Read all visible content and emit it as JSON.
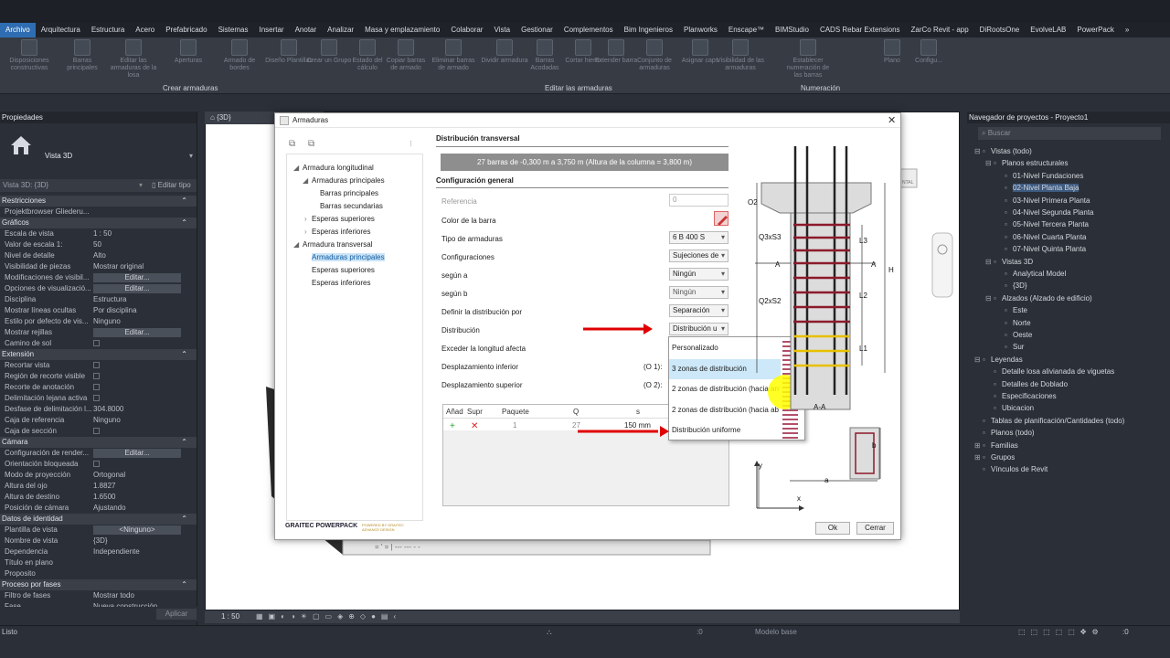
{
  "ribbon": {
    "tabs": [
      "Archivo",
      "Arquitectura",
      "Estructura",
      "Acero",
      "Prefabricado",
      "Sistemas",
      "Insertar",
      "Anotar",
      "Analizar",
      "Masa y emplazamiento",
      "Colaborar",
      "Vista",
      "Gestionar",
      "Complementos",
      "Bim Ingenieros",
      "Planworks",
      "Enscape™",
      "BIMStudio",
      "CADS Rebar Extensions",
      "ZarCo Revit - app",
      "DiRootsOne",
      "EvolveLAB",
      "PowerPack"
    ],
    "buttons": [
      "Disposiciones constructivas",
      "Barras principales",
      "Editar las armaduras de la losa",
      "Aperturas",
      "Armado de bordes",
      "Diseño Plantillas",
      "Crear un Grupo",
      "Estado del cálculo",
      "Copiar barras de armado",
      "Eliminar barras de armado",
      "Dividir armadura",
      "Barras Acodadas",
      "Cortar hierro",
      "Extender barra",
      "Conjunto de armaduras",
      "Asignar caps",
      "Visibilidad de las armaduras",
      "Establecer numeración de las barras",
      "Plano",
      "Configu..."
    ],
    "groups": [
      "Crear armaduras",
      "Editar las armaduras",
      "Numeración"
    ]
  },
  "properties": {
    "title": "Propiedades",
    "type_name": "Vista 3D",
    "selector": "Vista 3D: {3D}",
    "edit_type": "Editar tipo",
    "sections": [
      {
        "name": "Restricciones",
        "toggle": "⌃",
        "rows": [
          [
            "Projektbrowser Gliederu...",
            ""
          ]
        ]
      },
      {
        "name": "Gráficos",
        "toggle": "⌃",
        "rows": [
          [
            "Escala de vista",
            "1 : 50"
          ],
          [
            "Valor de escala    1:",
            "50"
          ],
          [
            "Nivel de detalle",
            "Alto"
          ],
          [
            "Visibilidad de piezas",
            "Mostrar original"
          ],
          [
            "Modificaciones de visibil...",
            "Editar..."
          ],
          [
            "Opciones de visualizació...",
            "Editar..."
          ],
          [
            "Disciplina",
            "Estructura"
          ],
          [
            "Mostrar líneas ocultas",
            "Por disciplina"
          ],
          [
            "Estilo por defecto de vis...",
            "Ninguno"
          ],
          [
            "Mostrar rejillas",
            "Editar..."
          ],
          [
            "Camino de sol",
            "☐"
          ]
        ]
      },
      {
        "name": "Extensión",
        "toggle": "⌃",
        "rows": [
          [
            "Recortar vista",
            "☐"
          ],
          [
            "Región de recorte visible",
            "☐"
          ],
          [
            "Recorte de anotación",
            "☐"
          ],
          [
            "Delimitación lejana activa",
            "☐"
          ],
          [
            "Desfase de delimitación l...",
            "304.8000"
          ],
          [
            "Caja de referencia",
            "Ninguno"
          ],
          [
            "Caja de sección",
            "☐"
          ]
        ]
      },
      {
        "name": "Cámara",
        "toggle": "⌃",
        "rows": [
          [
            "Configuración de render...",
            "Editar..."
          ],
          [
            "Orientación bloqueada",
            "☐"
          ],
          [
            "Modo de proyección",
            "Ortogonal"
          ],
          [
            "Altura del ojo",
            "1.8827"
          ],
          [
            "Altura de destino",
            "1.6500"
          ],
          [
            "Posición de cámara",
            "Ajustando"
          ]
        ]
      },
      {
        "name": "Datos de identidad",
        "toggle": "⌃",
        "rows": [
          [
            "Plantilla de vista",
            "<Ninguno>"
          ],
          [
            "Nombre de vista",
            "{3D}"
          ],
          [
            "Dependencia",
            "Independiente"
          ],
          [
            "Título en plano",
            ""
          ],
          [
            "Proposito",
            ""
          ]
        ]
      },
      {
        "name": "Proceso por fases",
        "toggle": "⌃",
        "rows": [
          [
            "Filtro de fases",
            "Mostrar todo"
          ],
          [
            "Fase",
            "Nueva construcción"
          ]
        ]
      }
    ],
    "apply": "Aplicar"
  },
  "viewport": {
    "tab": "{3D}",
    "scale": "1 : 50"
  },
  "status": {
    "left": "Listo",
    "model": "Modelo base",
    "count1": ":0",
    "count2": ":0"
  },
  "browser": {
    "title": "Navegador de proyectos - Proyecto1",
    "search": "Buscar",
    "items": [
      [
        "Vistas (todo)",
        0,
        "⊟"
      ],
      [
        "Planos estructurales",
        1,
        "⊟"
      ],
      [
        "01-Nivel Fundaciones",
        2,
        ""
      ],
      [
        "02-Nivel Planta Baja",
        2,
        ""
      ],
      [
        "03-Nivel Primera Planta",
        2,
        ""
      ],
      [
        "04-Nivel Segunda Planta",
        2,
        ""
      ],
      [
        "05-Nivel Tercera Planta",
        2,
        ""
      ],
      [
        "06-Nivel Cuarta Planta",
        2,
        ""
      ],
      [
        "07-Nivel Quinta Planta",
        2,
        ""
      ],
      [
        "Vistas 3D",
        1,
        "⊟"
      ],
      [
        "Analytical Model",
        2,
        ""
      ],
      [
        "{3D}",
        2,
        ""
      ],
      [
        "Alzados (Alzado de edificio)",
        1,
        "⊟"
      ],
      [
        "Este",
        2,
        ""
      ],
      [
        "Norte",
        2,
        ""
      ],
      [
        "Oeste",
        2,
        ""
      ],
      [
        "Sur",
        2,
        ""
      ],
      [
        "Leyendas",
        0,
        "⊟"
      ],
      [
        "Detalle losa alivianada de viguetas",
        1,
        ""
      ],
      [
        "Detalles de Doblado",
        1,
        ""
      ],
      [
        "Especificaciones",
        1,
        ""
      ],
      [
        "Ubicacion",
        1,
        ""
      ],
      [
        "Tablas de planificación/Cantidades (todo)",
        0,
        ""
      ],
      [
        "Planos (todo)",
        0,
        ""
      ],
      [
        "Familias",
        0,
        "⊞"
      ],
      [
        "Grupos",
        0,
        "⊞"
      ],
      [
        "Vínculos de Revit",
        0,
        ""
      ]
    ]
  },
  "dialog": {
    "title": "Armaduras",
    "tree": [
      "Armadura longitudinal",
      "Armaduras principales",
      "Barras principales",
      "Barras secundarias",
      "Esperas superiores",
      "Esperas inferiores",
      "Armadura transversal",
      "Armaduras principales",
      "Esperas superiores",
      "Esperas inferiores"
    ],
    "section1": "Distribución transversal",
    "summary": "27 barras de -0,300 m a 3,750 m (Altura de la columna = 3,800 m)",
    "section2": "Configuración general",
    "fields": {
      "referencia": "Referencia",
      "referencia_val": "0",
      "color": "Color de la barra",
      "tipo": "Tipo de armaduras",
      "tipo_val": "6 B 400 S",
      "config": "Configuraciones",
      "config_val": "Sujeciones de",
      "segun_a": "según a",
      "segun_a_val": "Ningún",
      "segun_b": "según b",
      "segun_b_val": "Ningún",
      "definir": "Definir la distribución por",
      "definir_val": "Separación",
      "distrib": "Distribución",
      "distrib_val": "Distribución u",
      "exceder": "Exceder la longitud afecta",
      "desp_inf": "Desplazamiento inferior",
      "desp_inf_code": "(O 1):",
      "desp_sup": "Desplazamiento superior",
      "desp_sup_code": "(O 2):"
    },
    "options": [
      "Personalizado",
      "3 zonas de distribución",
      "2 zonas de distribución (hacia arr",
      "2 zonas de distribución (hacia ab",
      "Distribución uniforme"
    ],
    "table": {
      "headers": [
        "Añad",
        "Supr",
        "Paquete",
        "Q",
        "s"
      ],
      "row": [
        "+",
        "✕",
        "1",
        "27",
        "150 mm"
      ]
    },
    "drawing": {
      "labels": [
        "O2",
        "Q3xS3",
        "Q2xS2",
        "L3",
        "L2",
        "L1",
        "H",
        "A",
        "A",
        "A-A",
        "b",
        "a",
        "y",
        "x"
      ]
    },
    "logo1": "GRAITEC POWERPACK",
    "logo2": "POWERED BY GRAITEC ADVANCE DESIGN",
    "ok": "Ok",
    "cancel": "Cerrar"
  },
  "colors": {
    "accent": "#2f6db3",
    "arrow": "#e00000",
    "highlight": "#ffff00",
    "rebar": "#8b1a2b",
    "stirrup": "#e8c000"
  }
}
